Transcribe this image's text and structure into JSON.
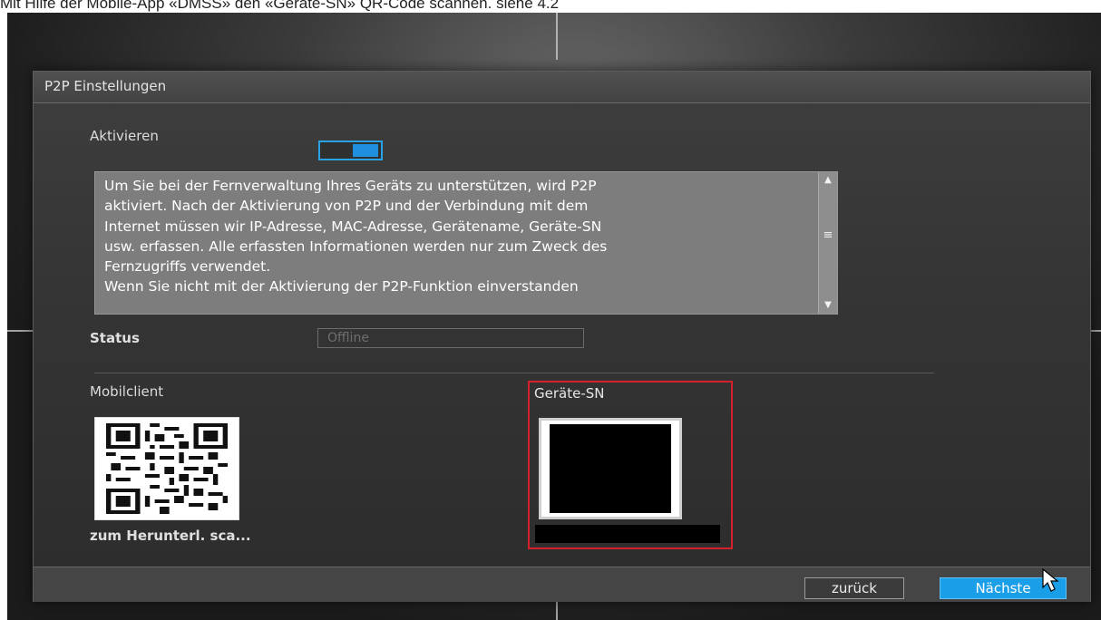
{
  "caption": "Mit Hilfe der Mobile-App «DMSS» den «Geräte-SN» QR-Code scannen. siehe 4.2",
  "panel": {
    "title": "P2P Einstellungen"
  },
  "enable": {
    "label": "Aktivieren",
    "state": "on"
  },
  "info_text": "Um Sie bei der Fernverwaltung Ihres Geräts zu unterstützen, wird P2P\naktiviert. Nach der Aktivierung von P2P und der Verbindung mit dem\nInternet müssen wir IP-Adresse, MAC-Adresse, Gerätename, Geräte-SN\nusw. erfassen. Alle erfassten Informationen werden nur zum Zweck des\nFernzugriffs verwendet.\nWenn Sie nicht mit der Aktivierung der P2P-Funktion einverstanden",
  "status": {
    "label": "Status",
    "value": "Offline"
  },
  "mobile_client": {
    "label": "Mobilclient",
    "caption": "zum Herunterl. sca..."
  },
  "device_sn": {
    "label": "Geräte-SN"
  },
  "buttons": {
    "back": "zurück",
    "next": "Nächste"
  },
  "colors": {
    "accent": "#1a9ee8",
    "highlight": "#d3202a"
  }
}
